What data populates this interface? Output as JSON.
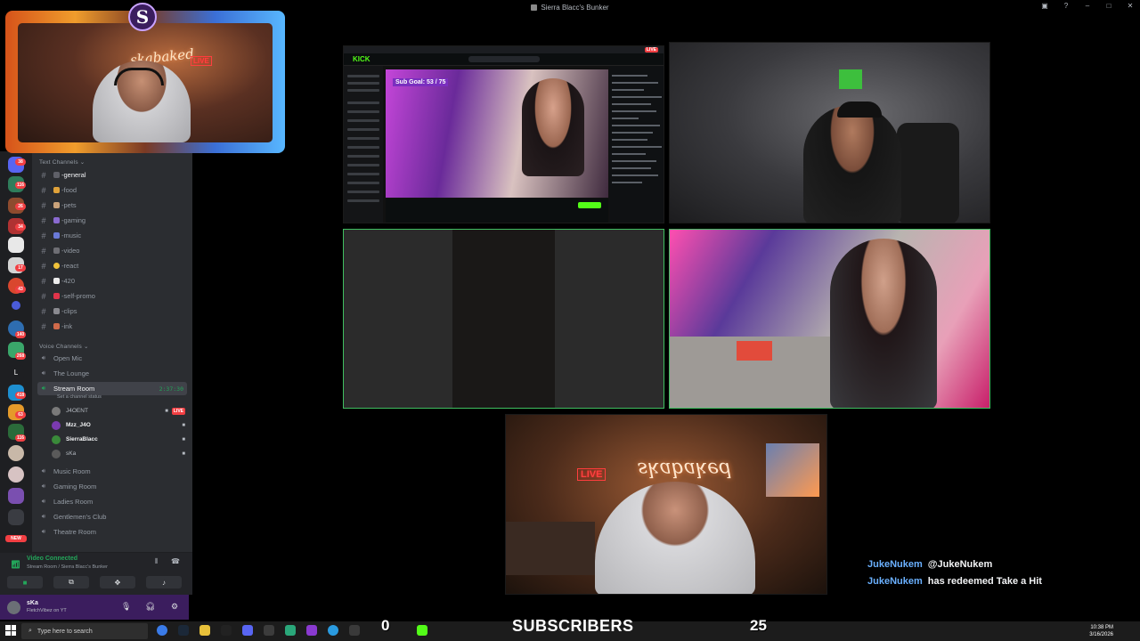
{
  "window": {
    "title": "Sierra Blacc's Bunker"
  },
  "server_rail": {
    "badges": [
      "38",
      "116",
      "26",
      "34",
      "17",
      "43",
      "140",
      "268",
      "418",
      "63",
      "116"
    ],
    "new_label": "NEW"
  },
  "sidebar": {
    "text_channels_label": "Text Channels",
    "text_channels": [
      {
        "name": "-general",
        "active": true
      },
      {
        "name": "-food"
      },
      {
        "name": "-pets"
      },
      {
        "name": "-gaming"
      },
      {
        "name": "-music"
      },
      {
        "name": "-video"
      },
      {
        "name": "-react"
      },
      {
        "name": "-420"
      },
      {
        "name": "-self-promo"
      },
      {
        "name": "-clips"
      },
      {
        "name": "-ink"
      }
    ],
    "voice_channels_label": "Voice Channels",
    "voice_channels_top": [
      {
        "name": "Open Mic"
      },
      {
        "name": "The Lounge"
      }
    ],
    "stream_room": {
      "name": "Stream Room",
      "timer": "2:37:30",
      "status": "Set a channel status"
    },
    "voice_users": [
      {
        "name": "J4OENT",
        "live": "LIVE"
      },
      {
        "name": "Mzz_J4O"
      },
      {
        "name": "SierraBlacc"
      },
      {
        "name": "sKa"
      }
    ],
    "voice_channels_bottom": [
      {
        "name": "Music Room"
      },
      {
        "name": "Gaming Room"
      },
      {
        "name": "Ladies Room"
      },
      {
        "name": "Gentlemen's Club"
      },
      {
        "name": "Theatre Room"
      }
    ]
  },
  "voice_panel": {
    "title": "Video Connected",
    "subtitle": "Stream Room / Sierra Blacc's Bunker"
  },
  "user_panel": {
    "name": "sKa",
    "status": "FletchVibez on YT"
  },
  "overlay": {
    "facecam_logo": "S",
    "facecam_neon": "skabaked",
    "facecam_live": "LIVE",
    "cam_neon": "skabaked",
    "cam_live": "LIVE",
    "kick_logo": "KICK",
    "kick_live": "LIVE",
    "kick_title": "Sub Goal: 53 / 75"
  },
  "chat_messages": [
    {
      "user": "JukeNukem",
      "text": "@JukeNukem"
    },
    {
      "user": "JukeNukem",
      "text": "has redeemed Take a Hit"
    }
  ],
  "counters": {
    "left": "0",
    "label": "SUBSCRIBERS",
    "right": "25"
  },
  "taskbar": {
    "search_placeholder": "Type here to search",
    "time": "10:38 PM",
    "date": "3/16/2026"
  }
}
